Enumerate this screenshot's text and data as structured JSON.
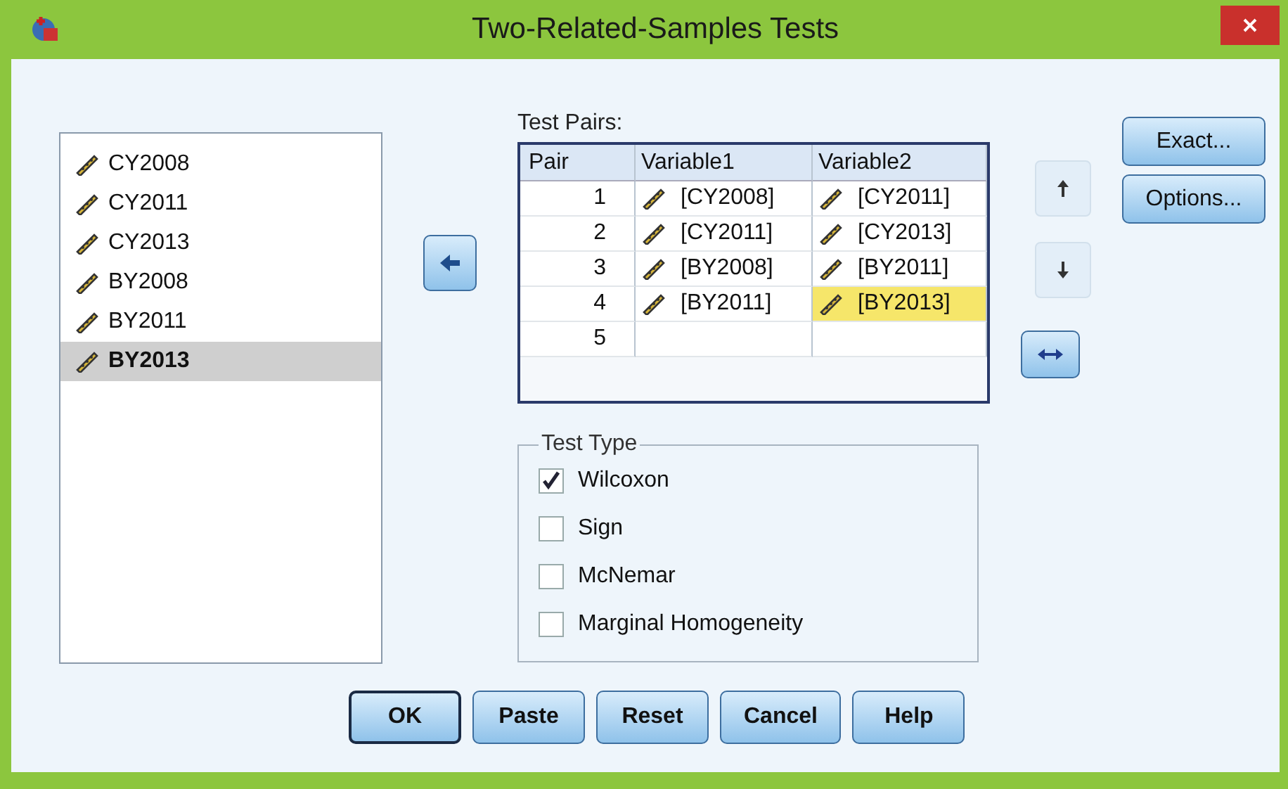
{
  "window": {
    "title": "Two-Related-Samples Tests"
  },
  "variables": [
    {
      "name": "CY2008",
      "selected": false
    },
    {
      "name": "CY2011",
      "selected": false
    },
    {
      "name": "CY2013",
      "selected": false
    },
    {
      "name": "BY2008",
      "selected": false
    },
    {
      "name": "BY2011",
      "selected": false
    },
    {
      "name": "BY2013",
      "selected": true
    }
  ],
  "test_pairs": {
    "label": "Test Pairs:",
    "columns": [
      "Pair",
      "Variable1",
      "Variable2"
    ],
    "rows": [
      {
        "pair": "1",
        "variable1": "[CY2008]",
        "variable2": "[CY2011]",
        "selected": false
      },
      {
        "pair": "2",
        "variable1": "[CY2011]",
        "variable2": "[CY2013]",
        "selected": false
      },
      {
        "pair": "3",
        "variable1": "[BY2008]",
        "variable2": "[BY2011]",
        "selected": false
      },
      {
        "pair": "4",
        "variable1": "[BY2011]",
        "variable2": "[BY2013]",
        "selected": true
      },
      {
        "pair": "5"
      }
    ]
  },
  "move_buttons": [
    {
      "kind": "up",
      "disabled": true
    },
    {
      "kind": "down",
      "disabled": true
    }
  ],
  "test_type": {
    "label": "Test Type",
    "options": [
      {
        "label": "Wilcoxon",
        "checked": true
      },
      {
        "label": "Sign",
        "checked": false
      },
      {
        "label": "McNemar",
        "checked": false
      },
      {
        "label": "Marginal Homogeneity",
        "checked": false
      }
    ]
  },
  "side_buttons": [
    "Exact...",
    "Options..."
  ],
  "buttons": [
    {
      "label": "OK",
      "default": true
    },
    {
      "label": "Paste",
      "default": false
    },
    {
      "label": "Reset",
      "default": false
    },
    {
      "label": "Cancel",
      "default": false
    },
    {
      "label": "Help",
      "default": false
    }
  ]
}
